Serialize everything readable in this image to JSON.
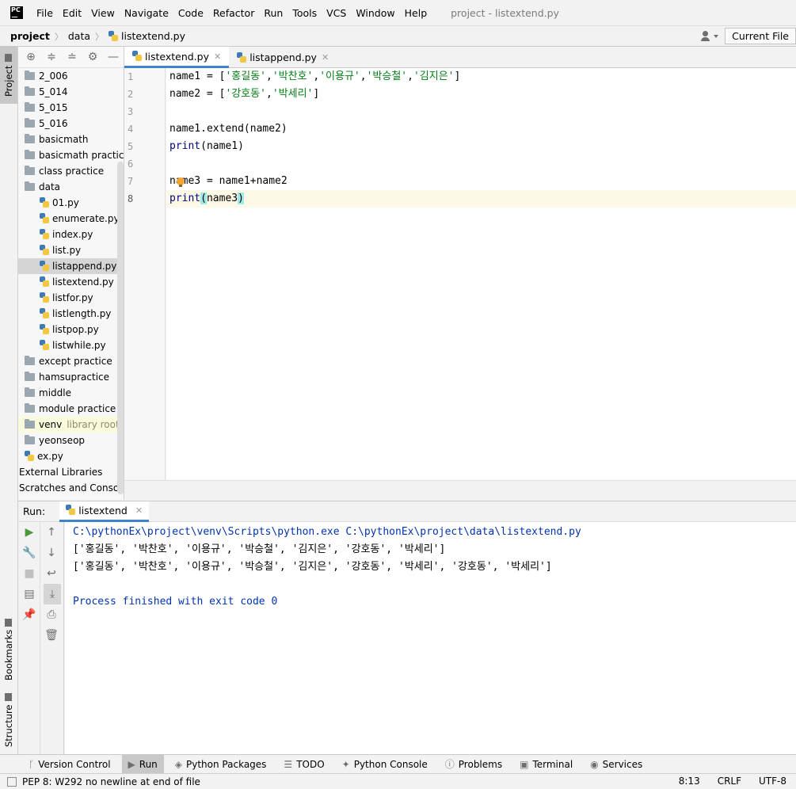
{
  "app": {
    "logo_text": "PC",
    "window_title": "project - listextend.py"
  },
  "menu": [
    "File",
    "Edit",
    "View",
    "Navigate",
    "Code",
    "Refactor",
    "Run",
    "Tools",
    "VCS",
    "Window",
    "Help"
  ],
  "breadcrumb": [
    "project",
    "data",
    "listextend.py"
  ],
  "run_config": "Current File",
  "left_strip": {
    "project": "Project",
    "bookmarks": "Bookmarks",
    "structure": "Structure"
  },
  "tree": [
    {
      "type": "folder",
      "label": "2_006",
      "indent": 0
    },
    {
      "type": "folder",
      "label": "5_014",
      "indent": 0
    },
    {
      "type": "folder",
      "label": "5_015",
      "indent": 0
    },
    {
      "type": "folder",
      "label": "5_016",
      "indent": 0
    },
    {
      "type": "folder",
      "label": "basicmath",
      "indent": 0
    },
    {
      "type": "folder",
      "label": "basicmath practice",
      "indent": 0
    },
    {
      "type": "folder",
      "label": "class practice",
      "indent": 0
    },
    {
      "type": "folder",
      "label": "data",
      "indent": 0
    },
    {
      "type": "file",
      "label": "01.py",
      "indent": 1
    },
    {
      "type": "file",
      "label": "enumerate.py",
      "indent": 1
    },
    {
      "type": "file",
      "label": "index.py",
      "indent": 1
    },
    {
      "type": "file",
      "label": "list.py",
      "indent": 1
    },
    {
      "type": "file",
      "label": "listappend.py",
      "indent": 1,
      "selected": true
    },
    {
      "type": "file",
      "label": "listextend.py",
      "indent": 1
    },
    {
      "type": "file",
      "label": "listfor.py",
      "indent": 1
    },
    {
      "type": "file",
      "label": "listlength.py",
      "indent": 1
    },
    {
      "type": "file",
      "label": "listpop.py",
      "indent": 1
    },
    {
      "type": "file",
      "label": "listwhile.py",
      "indent": 1
    },
    {
      "type": "folder",
      "label": "except practice",
      "indent": 0
    },
    {
      "type": "folder",
      "label": "hamsupractice",
      "indent": 0
    },
    {
      "type": "folder",
      "label": "middle",
      "indent": 0
    },
    {
      "type": "folder",
      "label": "module practice",
      "indent": 0
    },
    {
      "type": "folder",
      "label": "venv",
      "indent": 0,
      "suffix": "library root"
    },
    {
      "type": "folder",
      "label": "yeonseop",
      "indent": 0
    },
    {
      "type": "file",
      "label": "ex.py",
      "indent": 0
    },
    {
      "type": "plain",
      "label": "External Libraries",
      "indent": -1
    },
    {
      "type": "plain",
      "label": "Scratches and Consoles",
      "indent": -1
    }
  ],
  "editor_tabs": [
    {
      "label": "listextend.py",
      "active": true
    },
    {
      "label": "listappend.py",
      "active": false
    }
  ],
  "line_numbers": [
    "1",
    "2",
    "3",
    "4",
    "5",
    "6",
    "7",
    "8"
  ],
  "code_lines": [
    "name1 = ['홍길동','박찬호','이용규','박승철','김지은']",
    "name2 = ['강호동','박세리']",
    "",
    "name1.extend(name2)",
    "print(name1)",
    "",
    "name3 = name1+name2",
    "print(name3)"
  ],
  "run": {
    "label": "Run:",
    "tab_label": "listextend",
    "console": [
      "C:\\pythonEx\\project\\venv\\Scripts\\python.exe C:\\pythonEx\\project\\data\\listextend.py",
      "['홍길동', '박찬호', '이용규', '박승철', '김지은', '강호동', '박세리']",
      "['홍길동', '박찬호', '이용규', '박승철', '김지은', '강호동', '박세리', '강호동', '박세리']",
      "",
      "Process finished with exit code 0"
    ]
  },
  "tool_windows": [
    {
      "label": "Version Control",
      "icon": "branch-icon"
    },
    {
      "label": "Run",
      "icon": "play-icon",
      "active": true
    },
    {
      "label": "Python Packages",
      "icon": "layers-icon"
    },
    {
      "label": "TODO",
      "icon": "list-icon"
    },
    {
      "label": "Python Console",
      "icon": "python-icon"
    },
    {
      "label": "Problems",
      "icon": "info-icon"
    },
    {
      "label": "Terminal",
      "icon": "terminal-icon"
    },
    {
      "label": "Services",
      "icon": "services-icon"
    }
  ],
  "status": {
    "message": "PEP 8: W292 no newline at end of file",
    "position": "8:13",
    "line_sep": "CRLF",
    "encoding": "UTF-8"
  },
  "colors": {
    "accent": "#4083c9",
    "string": "#067d17",
    "builtin": "#000080",
    "console_blue": "#0033b3"
  }
}
